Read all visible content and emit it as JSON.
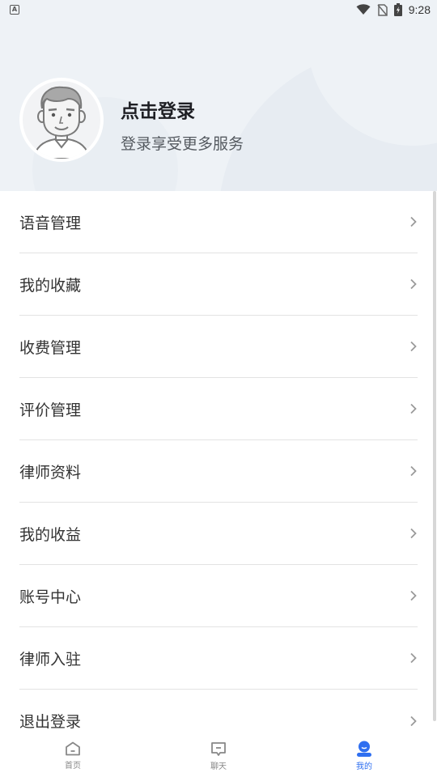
{
  "status_bar": {
    "time": "9:28",
    "notification_icon": "app-notification-icon",
    "icons": [
      "wifi-icon",
      "no-sim-icon",
      "battery-charging-icon"
    ]
  },
  "profile": {
    "title": "点击登录",
    "subtitle": "登录享受更多服务",
    "avatar_icon": "default-avatar"
  },
  "menu": {
    "items": [
      {
        "label": "语音管理"
      },
      {
        "label": "我的收藏"
      },
      {
        "label": "收费管理"
      },
      {
        "label": "评价管理"
      },
      {
        "label": "律师资料"
      },
      {
        "label": "我的收益"
      },
      {
        "label": "账号中心"
      },
      {
        "label": "律师入驻"
      },
      {
        "label": "退出登录"
      }
    ]
  },
  "tabbar": {
    "tabs": [
      {
        "label": "首页",
        "icon": "home-icon",
        "active": false
      },
      {
        "label": "聊天",
        "icon": "chat-icon",
        "active": false
      },
      {
        "label": "我的",
        "icon": "profile-icon",
        "active": true
      }
    ],
    "active_color": "#2f6ff0",
    "inactive_color": "#888888"
  }
}
